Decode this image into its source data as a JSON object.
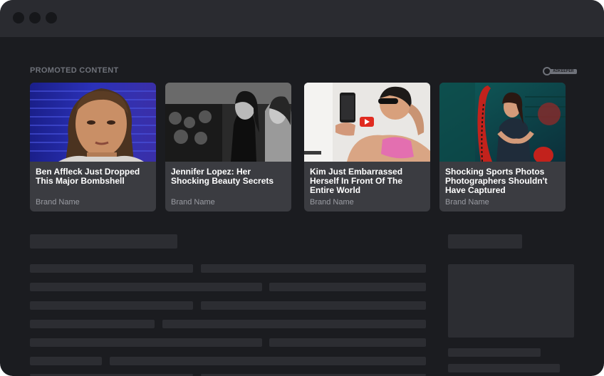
{
  "promoted_section": {
    "label": "PROMOTED CONTENT",
    "logo_text": "ADKEEPER"
  },
  "cards": [
    {
      "title": "Ben Affleck Just Dropped This Major Bombshell",
      "brand": "Brand Name",
      "image": "woman-portrait-blue-stage"
    },
    {
      "title": "Jennifer Lopez: Her Shocking Beauty Secrets",
      "brand": "Brand Name",
      "image": "black-and-white-crowd"
    },
    {
      "title": "Kim Just Embarrassed Herself In Front Of The Entire World",
      "brand": "Brand Name",
      "image": "selfie-video"
    },
    {
      "title": "Shocking Sports Photos Photographers Shouldn't Have Captured",
      "brand": "Brand Name",
      "image": "gym-battle-ropes"
    }
  ],
  "icons": {
    "window_controls": [
      "window-dot-icon",
      "window-dot-icon",
      "window-dot-icon"
    ],
    "video_play": "play-icon",
    "logo": "key-icon"
  },
  "colors": {
    "window_bg": "#1b1c20",
    "titlebar_bg": "#2a2b30",
    "card_bg": "#3b3c41",
    "skeleton": "#2c2d32",
    "play_red": "#e02b20"
  }
}
